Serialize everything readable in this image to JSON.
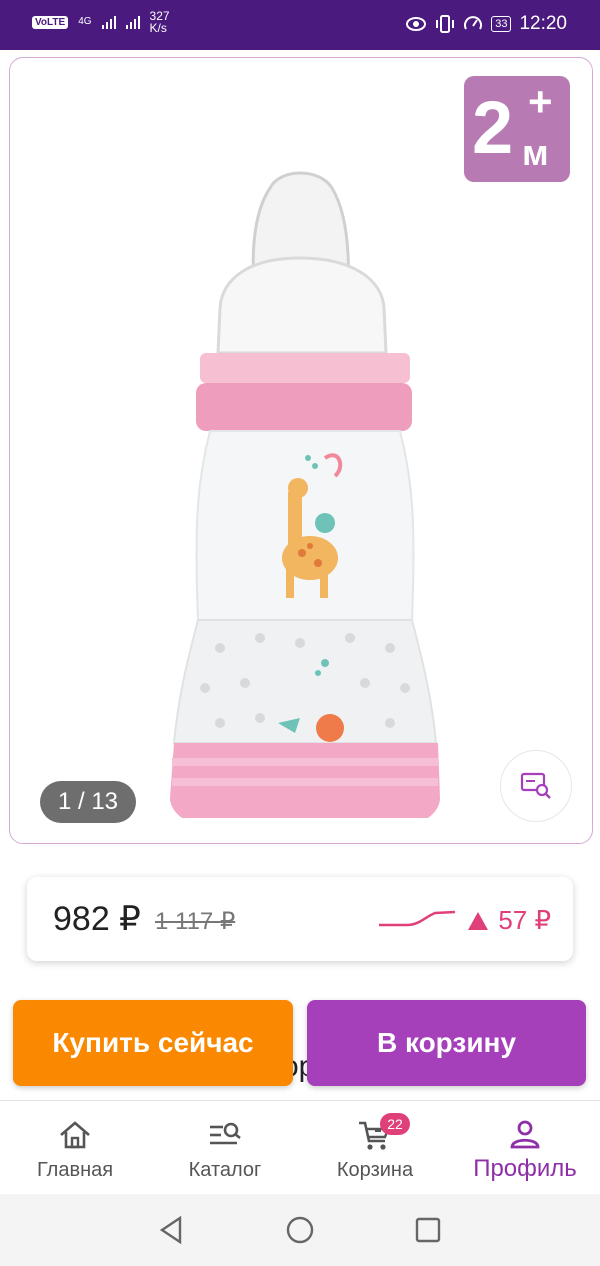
{
  "status_bar": {
    "volte": "VoLTE",
    "network": "4G",
    "speed_value": "327",
    "speed_unit": "K/s",
    "battery": "33",
    "time": "12:20"
  },
  "gallery": {
    "age_badge_number": "2",
    "age_badge_plus": "+",
    "age_badge_unit": "м",
    "counter": "1 / 13"
  },
  "price": {
    "current": "982 ₽",
    "old": "1 117 ₽",
    "change": "57 ₽"
  },
  "actions": {
    "buy_now": "Купить сейчас",
    "add_to_cart": "В корзину"
  },
  "hidden_text": "ор",
  "nav": {
    "items": [
      {
        "label": "Главная",
        "icon": "home-icon"
      },
      {
        "label": "Каталог",
        "icon": "catalog-search-icon"
      },
      {
        "label": "Корзина",
        "icon": "cart-icon",
        "badge": "22"
      },
      {
        "label": "Профиль",
        "icon": "profile-icon",
        "active": true
      }
    ]
  },
  "colors": {
    "status_bar": "#4a1a7f",
    "buy_now": "#fa8800",
    "add_to_cart": "#a53fba",
    "accent": "#8e2fa8",
    "price_up": "#e0407a"
  }
}
